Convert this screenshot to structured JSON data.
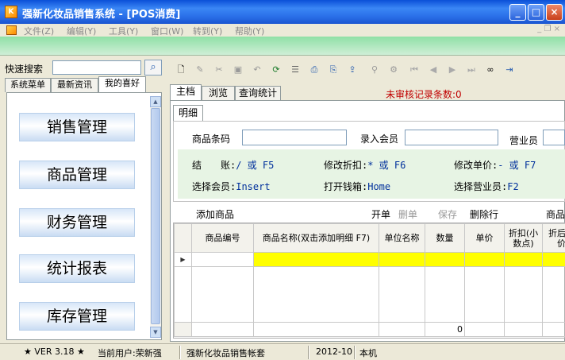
{
  "window": {
    "title": "强新化妆品销售系统 - [POS消费]",
    "app_icon": "app-logo-icon",
    "controls": [
      "_",
      "□",
      "×"
    ]
  },
  "menu": {
    "items": [
      "文件(Z)",
      "编辑(Y)",
      "工具(Y)",
      "窗口(W)",
      "转到(Y)",
      "帮助(Y)"
    ],
    "mdi_controls": "_ ❐ ×"
  },
  "left": {
    "search_label": "快速搜索",
    "search_value": "",
    "tabs": [
      "系统菜单",
      "最新资讯",
      "我的喜好"
    ],
    "nav": [
      "销售管理",
      "商品管理",
      "财务管理",
      "统计报表",
      "库存管理"
    ]
  },
  "toolbar": {
    "icons": [
      "new-icon",
      "edit-icon",
      "cut-icon",
      "save-icon",
      "undo-icon",
      "refresh-icon",
      "list-icon",
      "preview-icon",
      "print-icon",
      "export-icon",
      "filter-icon",
      "settings-icon",
      "first-icon",
      "prev-icon",
      "next-icon",
      "last-icon",
      "binoculars-icon",
      "exit-icon"
    ]
  },
  "right": {
    "tabs": [
      "主档",
      "浏览",
      "查询统计"
    ],
    "pending_text": "未审核记录条数:0",
    "sub_tab": "明细",
    "fields": {
      "barcode_label": "商品条码",
      "member_label": "录入会员",
      "clerk_label": "营业员"
    },
    "hints": [
      {
        "label": "结　　账:",
        "key": "/ 或 F5"
      },
      {
        "label": "修改折扣:",
        "key": "* 或 F6"
      },
      {
        "label": "修改单价:",
        "key": "- 或 F7"
      },
      {
        "label": "选择会员:",
        "key": "Insert"
      },
      {
        "label": "打开钱箱:",
        "key": "Home"
      },
      {
        "label": "选择营业员:",
        "key": "F2"
      }
    ],
    "grid_toolbar": {
      "add": "添加商品",
      "open": "开单",
      "delete": "删单",
      "save": "保存",
      "delete_row": "删除行",
      "goods": "商品"
    },
    "grid": {
      "columns": [
        "商品编号",
        "商品名称(双击添加明细 F7)",
        "单位名称",
        "数量",
        "单价",
        "折扣(小数点)",
        "折后单价"
      ],
      "rows": [
        [
          "",
          "",
          "",
          "",
          "",
          "",
          ""
        ]
      ],
      "total_qty": "0"
    }
  },
  "status": {
    "version": "★ VER 3.18 ★",
    "user": "当前用户:荣新强",
    "account": "强新化妆品销售帐套",
    "period": "2012-10",
    "host": "本机"
  },
  "colors": {
    "titlebar": "#2a6fe8",
    "greenbar": "#8fe0a6",
    "highlight_row": "#ffff00",
    "pending": "#c00000"
  }
}
